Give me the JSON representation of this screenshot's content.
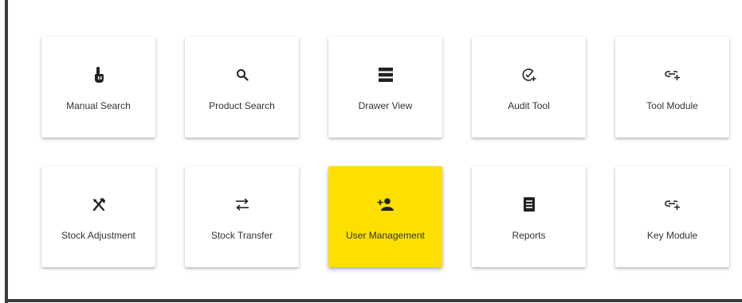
{
  "modules": [
    {
      "label": "Manual Search",
      "icon": "touch-hand-icon"
    },
    {
      "label": "Product Search",
      "icon": "search-icon"
    },
    {
      "label": "Drawer View",
      "icon": "drawer-stack-icon"
    },
    {
      "label": "Audit Tool",
      "icon": "check-add-icon"
    },
    {
      "label": "Tool Module",
      "icon": "link-add-icon"
    },
    {
      "label": "Stock Adjustment",
      "icon": "tools-icon"
    },
    {
      "label": "Stock Transfer",
      "icon": "transfer-arrows-icon"
    },
    {
      "label": "User Management",
      "icon": "add-user-icon",
      "active": true
    },
    {
      "label": "Reports",
      "icon": "document-list-icon"
    },
    {
      "label": "Key Module",
      "icon": "link-add-icon"
    }
  ],
  "colors": {
    "active_tile": "#fde000",
    "tile": "#ffffff",
    "text": "#333333",
    "icon": "#222222",
    "frame_rule": "#3a3a3a"
  }
}
